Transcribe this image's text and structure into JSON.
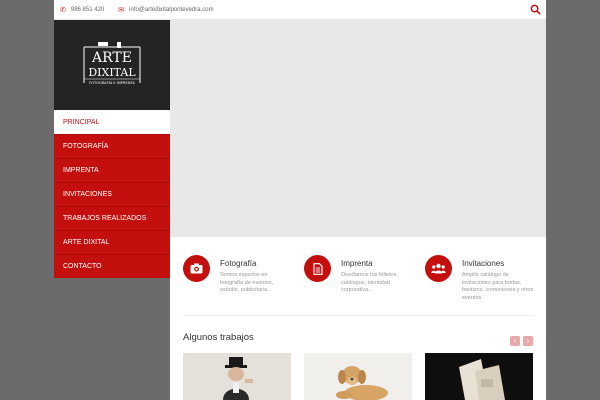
{
  "topbar": {
    "phone": "986 851 420",
    "email": "info@artedixitalpontevedra.com",
    "phone_icon": "phone-icon",
    "email_icon": "envelope-icon",
    "search_icon": "search-icon"
  },
  "logo": {
    "line1": "ARTE",
    "line2": "DIXITAL",
    "tagline": "FOTOGRAFÍA E IMPRENTA"
  },
  "menu": [
    {
      "label": "PRINCIPAL",
      "active": true
    },
    {
      "label": "FOTOGRAFÍA"
    },
    {
      "label": "IMPRENTA"
    },
    {
      "label": "INVITACIONES"
    },
    {
      "label": "TRABAJOS REALIZADOS"
    },
    {
      "label": "ARTE DIXITAL"
    },
    {
      "label": "CONTACTO"
    }
  ],
  "features": [
    {
      "title": "Fotografía",
      "desc": "Somos expertos en fotografía de eventos, estudio, publicitaria...",
      "icon": "camera-icon"
    },
    {
      "title": "Imprenta",
      "desc": "Diseñamos tus folletos, catálogos, identidad corporativa...",
      "icon": "document-icon"
    },
    {
      "title": "Invitaciones",
      "desc": "Amplio catálogo de invitaciones para bodas, bautizos, comuniones y otros eventos.",
      "icon": "group-icon"
    }
  ],
  "works": {
    "title": "Algunos trabajos",
    "prev_icon": "chevron-left-icon",
    "next_icon": "chevron-right-icon"
  },
  "colors": {
    "accent": "#c40f0f",
    "page_bg": "#6b6b6b",
    "logo_bg": "#242424",
    "hero_bg": "#e8e8e8"
  }
}
